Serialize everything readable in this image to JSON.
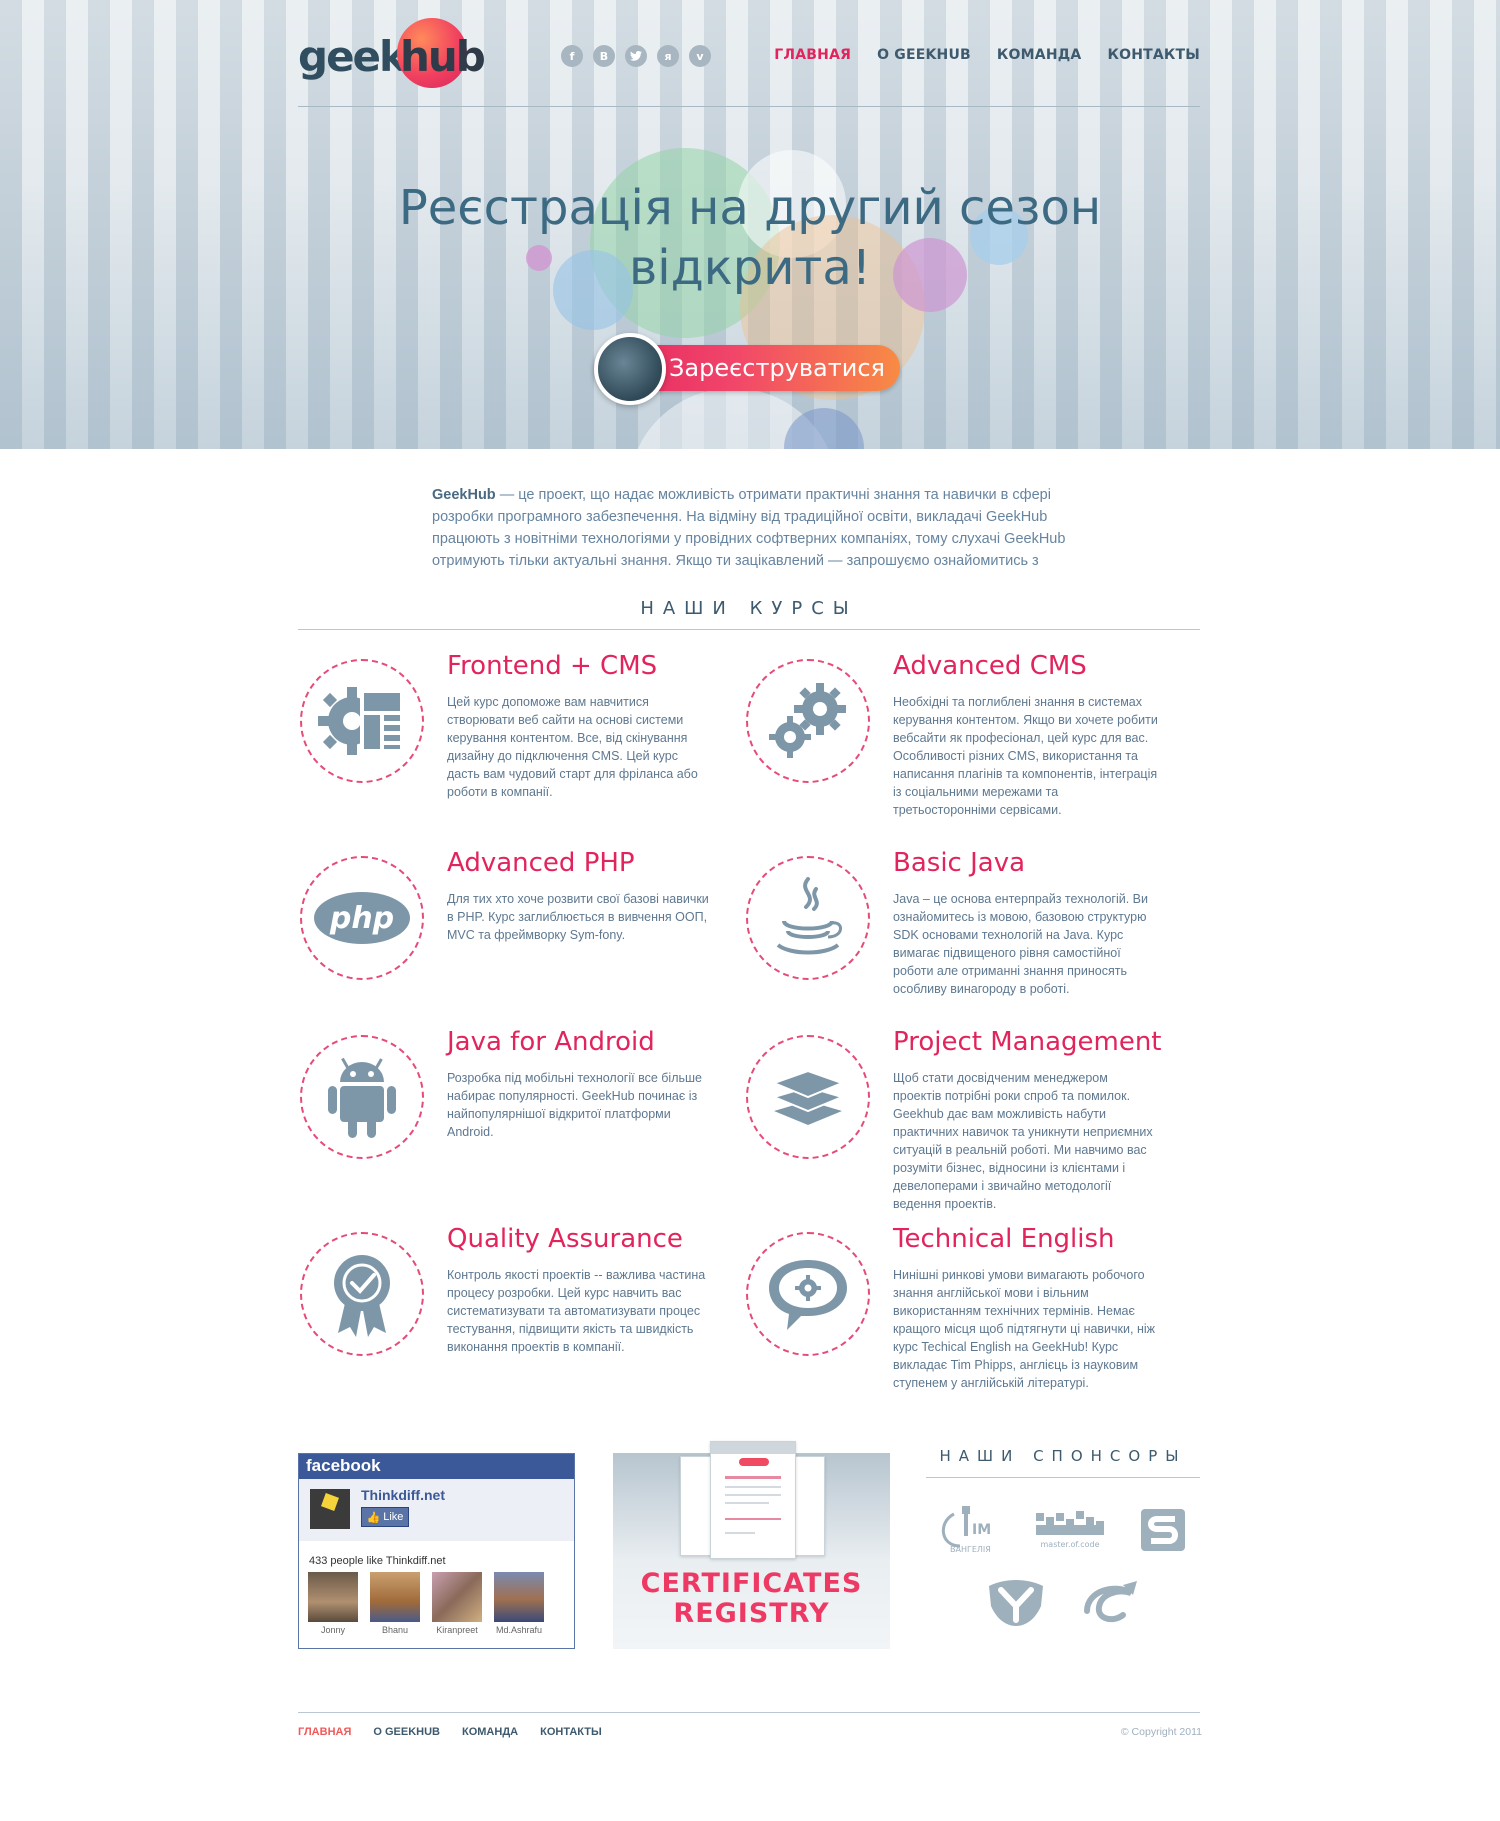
{
  "header": {
    "logo": {
      "left": "geek",
      "right": "hub"
    },
    "social": [
      {
        "icon": "facebook-icon",
        "glyph": "f"
      },
      {
        "icon": "vkontakte-icon",
        "glyph": "B"
      },
      {
        "icon": "twitter-icon",
        "glyph": "t"
      },
      {
        "icon": "ya-ru-icon",
        "glyph": "я"
      },
      {
        "icon": "vimeo-icon",
        "glyph": "v"
      }
    ],
    "nav": [
      "ГЛАВНАЯ",
      "О GEEKHUB",
      "КОМАНДА",
      "КОНТАКТЫ"
    ],
    "active_nav": "ГЛАВНАЯ"
  },
  "hero": {
    "title_line1": "Реєстрація на другий сезон",
    "title_line2": "відкрита!",
    "cta_label": "Зареєструватися"
  },
  "intro": {
    "brand": "GeekHub",
    "text": " — це проект, що надає можливість отримати практичні знання та навички в сфері розробки програмного забезпечення. На відміну від традиційної освіти, викладачі GeekHub працюють з новітніми технологіями у провідних софтверних компаніях, тому слухачі GeekHub отримують тільки актуальні знання. Якщо ти зацікавлений — запрошуємо ознайомитись з"
  },
  "courses": {
    "heading": "НАШИ КУРСЫ",
    "items": [
      {
        "title": "Frontend + CMS",
        "icon": "gear-layout-icon",
        "text": "Цей курс допоможе вам навчитися створювати веб сайти на основі системи керування контентом. Все, від скінування дизайну до підключення CMS. Цей курс дасть вам чудовий старт для фріланса або роботи в компанії."
      },
      {
        "title": "Advanced CMS",
        "icon": "gears-icon",
        "text": "Необхідні та поглиблені знання в системах керування контентом. Якщо ви хочете робити вебсайти як професіонал, цей курс для вас. Особливості різних CMS, використання та написання плагінів та компонентів, інтеграція із соціальними мережами та третьосторонніми сервісами."
      },
      {
        "title": "Advanced PHP",
        "icon": "php-icon",
        "text": "Для тих хто хоче розвити свої базові навички в PHP. Курс заглиблюється в вивчення ООП, MVC та фреймворку Sym-fony."
      },
      {
        "title": "Basic Java",
        "icon": "java-cup-icon",
        "text": "Java – це основа ентерпрайз технологій. Ви ознайомитесь із мовою, базовою структурю SDK основами технологій на Java. Курс вимагає підвищеного рівня самостійної роботи але отриманні знання приносять особливу винагороду в роботі."
      },
      {
        "title": "Java for Android",
        "icon": "android-icon",
        "text": "Розробка під мобільні технології все більше набирає популярності. GeekHub починає із найпопулярнішої відкритої платформи Android."
      },
      {
        "title": "Project Management",
        "icon": "layers-icon",
        "text": "Щоб стати досвідченим менеджером проектів потрібні роки спроб та помилок. Geekhub дає вам можливість набути практичних навичок та уникнути неприємних ситуацій в реальній роботі. Ми навчимо вас розуміти бізнес, відносини із клієнтами і девелоперами і звичайно методології ведення проектів."
      },
      {
        "title": "Quality Assurance",
        "icon": "award-badge-icon",
        "text": "Контроль якості проектів -- важлива частина процесу розробки. Цей курс навчить вас систематизувати та автоматизувати процес тестування, підвищити якість та швидкість виконання проектів в компанії."
      },
      {
        "title": "Technical English",
        "icon": "speech-gear-icon",
        "text": "Нинішні ринкові умови вимагають робочого знання англійської мови і вільним використанням технічних термінів. Немає кращого місця щоб підтягнути ці навички, ніж курс Techical English на GeekHub! Курс викладає Tim Phipps, англієць із науковим ступенем у англійській літературі."
      }
    ]
  },
  "facebook": {
    "brand": "facebook",
    "page_name": "Thinkdiff.net",
    "like_label": "Like",
    "count_text": "433 people like Thinkdiff.net",
    "people": [
      "Jonny",
      "Bhanu",
      "Kiranpreet",
      "Md.Ashrafu"
    ]
  },
  "certificates": {
    "line1": "CERTIFICATES",
    "line2": "REGISTRY"
  },
  "sponsors": {
    "heading": "НАШИ СПОНСОРЫ",
    "logos": [
      "im-vangelia-logo",
      "master-of-code-logo",
      "s-logo",
      "y-logo",
      "swirl-logo"
    ],
    "texts": {
      "im": "IM",
      "vangelia": "ВАНГЕЛІЯ",
      "moc": "master.of.code"
    }
  },
  "footer": {
    "nav": [
      "ГЛАВНАЯ",
      "О GEEKHUB",
      "КОМАНДА",
      "КОНТАКТЫ"
    ],
    "copyright": "© Copyright 2011"
  },
  "colors": {
    "accent": "#e2245c",
    "navy": "#3d5a6e",
    "text": "#5e7890",
    "facebook": "#3b5998"
  }
}
